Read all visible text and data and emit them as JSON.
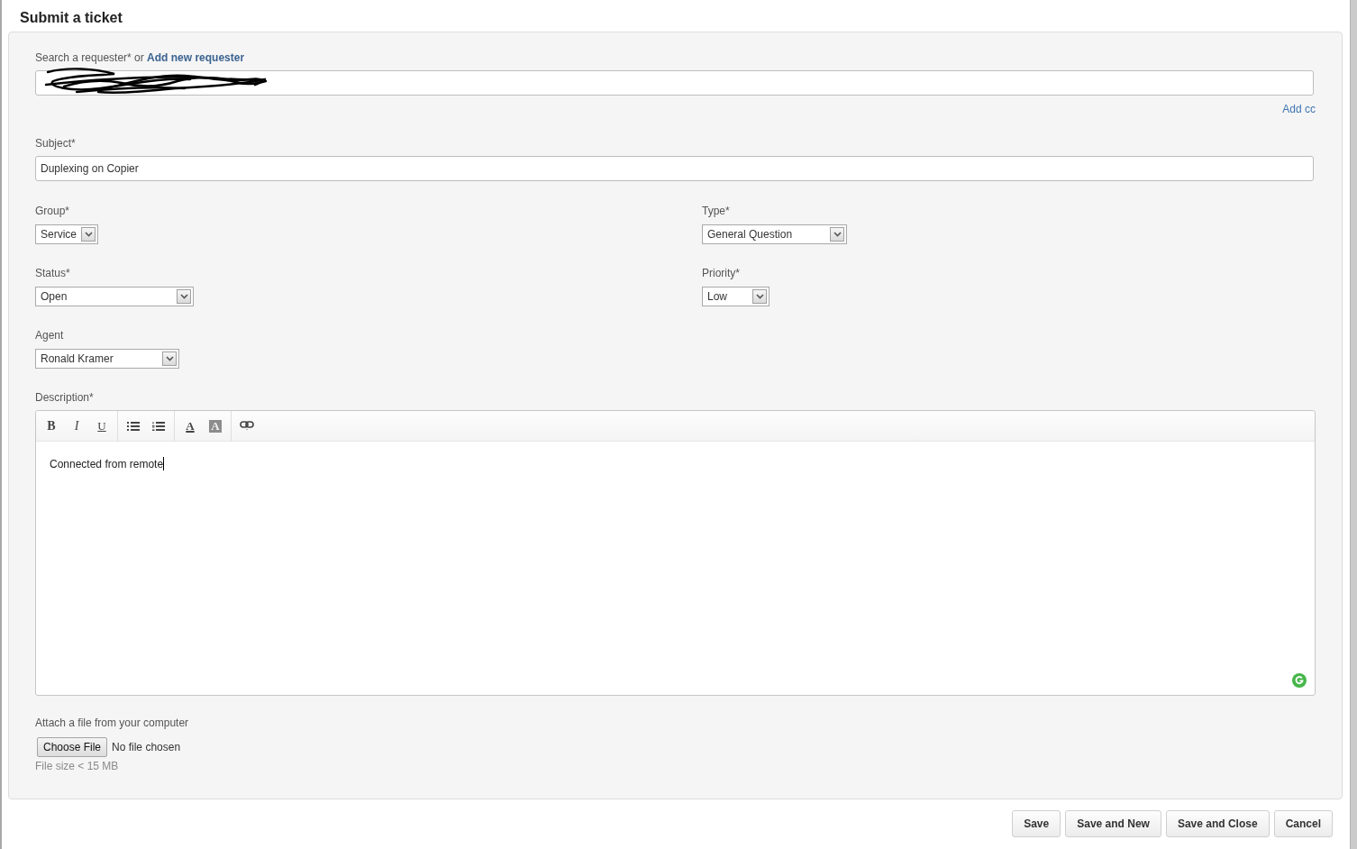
{
  "title": "Submit a ticket",
  "requester": {
    "label": "Search a requester* or",
    "link": "Add new requester",
    "redacted": true
  },
  "add_cc": "Add cc",
  "subject": {
    "label": "Subject*",
    "value": "Duplexing on Copier"
  },
  "fields": [
    {
      "label": "Group*",
      "value": "Service"
    },
    {
      "label": "Type*",
      "value": "General Question"
    },
    {
      "label": "Status*",
      "value": "Open"
    },
    {
      "label": "Priority*",
      "value": "Low"
    },
    {
      "label": "Agent",
      "value": "Ronald Kramer"
    }
  ],
  "description": {
    "label": "Description*",
    "toolbar": [
      [
        {
          "kind": "bold",
          "label": "B"
        },
        {
          "kind": "italic",
          "label": "I"
        },
        {
          "kind": "underline",
          "label": "U"
        }
      ],
      [
        {
          "kind": "bullets"
        },
        {
          "kind": "numbering"
        }
      ],
      [
        {
          "kind": "fontcolor",
          "label": "A"
        },
        {
          "kind": "highlight",
          "label": "A"
        }
      ],
      [
        {
          "kind": "link"
        }
      ]
    ],
    "text": "Connected from remote",
    "cursor": true
  },
  "attachment": {
    "label": "Attach a file from your computer",
    "button": "Choose File",
    "status": "No file chosen",
    "hint": "File size < 15 MB"
  },
  "buttons": [
    "Save",
    "Save and New",
    "Save and Close",
    "Cancel"
  ]
}
